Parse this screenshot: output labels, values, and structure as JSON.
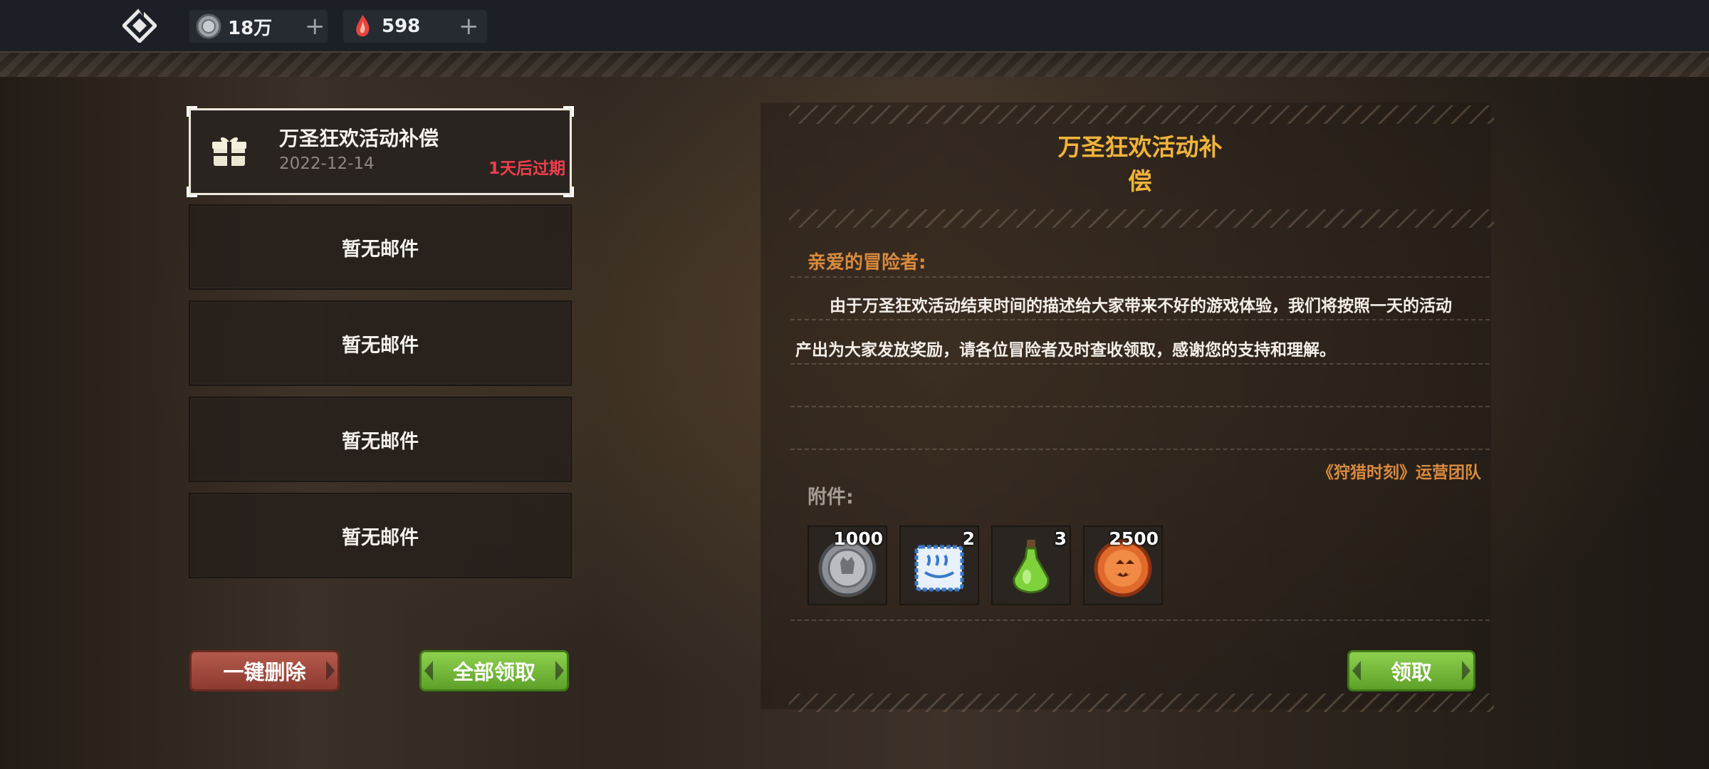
{
  "top_bar": {
    "silver": "18万",
    "gems": "598",
    "plus": "+"
  },
  "mail_list": {
    "selected": {
      "title": "万圣狂欢活动补偿",
      "date": "2022-12-14",
      "expiry": "1天后过期"
    },
    "empty_slots": [
      "暂无邮件",
      "暂无邮件",
      "暂无邮件",
      "暂无邮件"
    ],
    "delete_all_label": "一键删除",
    "claim_all_label": "全部领取"
  },
  "mail_detail": {
    "title": "万圣狂欢活动补偿",
    "greeting": "亲爱的冒险者:",
    "body_line1": "由于万圣狂欢活动结束时间的描述给大家带来不好的游戏体验，我们将按照一天的活动",
    "body_line2": "产出为大家发放奖励，请各位冒险者及时查收领取，感谢您的支持和理解。",
    "signature": "《狩猎时刻》运营团队",
    "attachments_label": "附件:",
    "attachments": [
      {
        "icon": "silver-coin-icon",
        "count": "1000"
      },
      {
        "icon": "scroll-ticket-icon",
        "count": "2"
      },
      {
        "icon": "green-potion-icon",
        "count": "3"
      },
      {
        "icon": "pumpkin-coin-icon",
        "count": "2500"
      }
    ],
    "claim_label": "领取"
  },
  "colors": {
    "accent_gold": "#f1b43a",
    "accent_orange": "#d98a3e",
    "expiry_red": "#ef3f4c",
    "button_green": "#6db335",
    "button_red": "#9e4a3e"
  }
}
